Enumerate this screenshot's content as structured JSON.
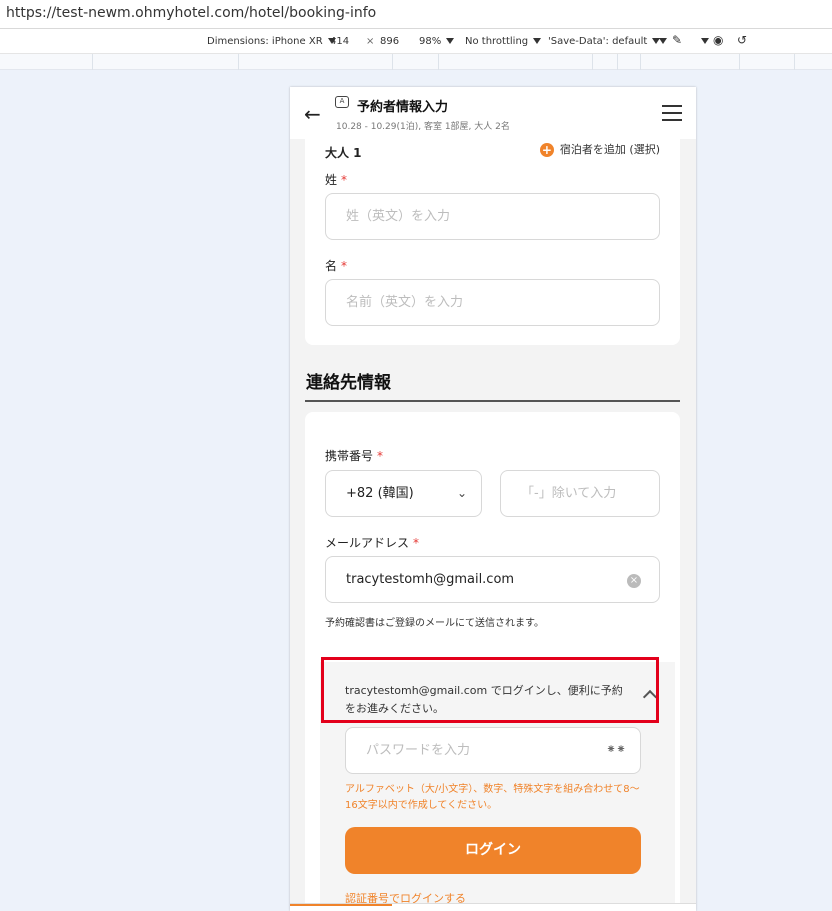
{
  "browser": {
    "url": "https://test-newm.ohmyhotel.com/hotel/booking-info"
  },
  "devtools": {
    "dimensions_label": "Dimensions: iPhone XR",
    "width": "414",
    "times": "×",
    "height": "896",
    "zoom": "98%",
    "throttling": "No throttling",
    "save_data": "'Save-Data': default"
  },
  "header": {
    "back_icon": "arrow-left-icon",
    "title": "予約者情報入力",
    "subtitle": "10.28 - 10.29(1泊), 客室 1部屋, 大人 2名",
    "menu_icon": "hamburger-icon"
  },
  "guest": {
    "label": "大人 1",
    "add_guest": "宿泊者を追加 (選択)",
    "last_name_label": "姓",
    "last_name_placeholder": "姓（英文）を入力",
    "first_name_label": "名",
    "first_name_placeholder": "名前（英文）を入力",
    "required_mark": "*"
  },
  "contact": {
    "section_title": "連絡先情報",
    "phone_label": "携帯番号",
    "country_code": "+82 (韓国)",
    "phone_placeholder": "「-」除いて入力",
    "email_label": "メールアドレス",
    "email_value": "tracytestomh@gmail.com",
    "email_note": "予約確認書はご登録のメールにて送信されます。",
    "required_mark": "*"
  },
  "login": {
    "prompt": "tracytestomh@gmail.com でログインし、便利に予約をお進みください。",
    "password_placeholder": "パスワードを入力",
    "password_note": "アルファベット（大/小文字）、数字、特殊文字を組み合わせて8～16文字以内で作成してください。",
    "login_button": "ログイン",
    "code_login_link": "認証番号でログインする"
  },
  "colors": {
    "accent": "#f0832a",
    "required": "#e53935",
    "highlight_box": "#e3001b"
  }
}
